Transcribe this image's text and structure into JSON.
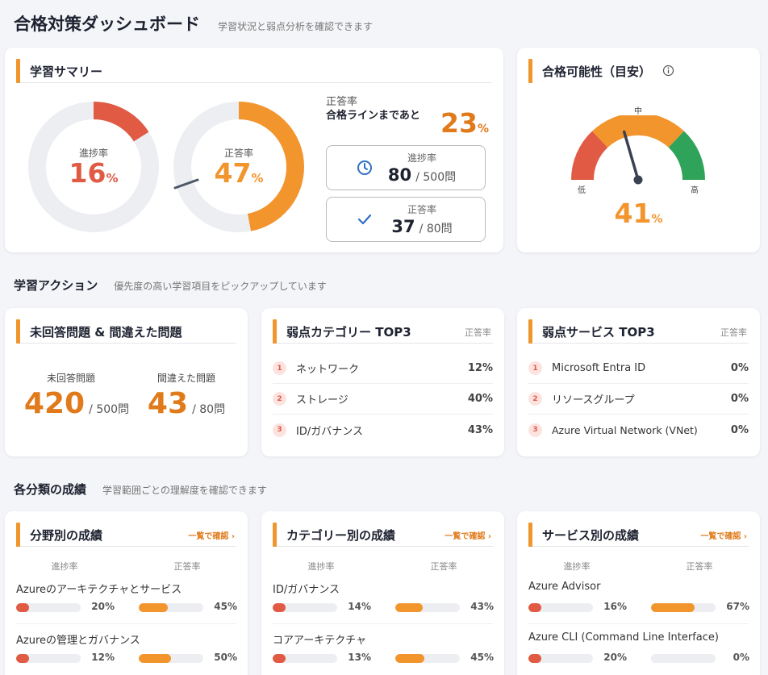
{
  "header": {
    "title": "合格対策ダッシュボード",
    "subtitle": "学習状況と弱点分析を確認できます"
  },
  "summary": {
    "title": "学習サマリー",
    "progress": {
      "label": "進捗率",
      "value": "16",
      "unit": "%",
      "fraction": 0.16
    },
    "accuracy": {
      "label": "正答率",
      "value": "47",
      "unit": "%",
      "fraction": 0.47
    },
    "gap": {
      "label": "正答率",
      "text": "合格ラインまであと",
      "value": "23",
      "unit": "%"
    },
    "progress_box": {
      "label": "進捗率",
      "value": "80",
      "total": "/ 500問"
    },
    "accuracy_box": {
      "label": "正答率",
      "value": "37",
      "total": "/ 80問"
    }
  },
  "pass": {
    "title": "合格可能性（目安）",
    "low": "低",
    "mid": "中",
    "high": "高",
    "value": "41",
    "unit": "%",
    "fraction": 0.41
  },
  "actions": {
    "title": "学習アクション",
    "subtitle": "優先度の高い学習項目をピックアップしています",
    "unanswered": {
      "title": "未回答問題 & 間違えた問題",
      "unanswered_label": "未回答問題",
      "unanswered_value": "420",
      "unanswered_total": "/ 500問",
      "wrong_label": "間違えた問題",
      "wrong_value": "43",
      "wrong_total": "/ 80問"
    },
    "weak_categories": {
      "title": "弱点カテゴリー TOP3",
      "right": "正答率",
      "items": [
        {
          "rank": "1",
          "name": "ネットワーク",
          "value": "12%"
        },
        {
          "rank": "2",
          "name": "ストレージ",
          "value": "40%"
        },
        {
          "rank": "3",
          "name": "ID/ガバナンス",
          "value": "43%"
        }
      ]
    },
    "weak_services": {
      "title": "弱点サービス TOP3",
      "right": "正答率",
      "items": [
        {
          "rank": "1",
          "name": "Microsoft Entra ID",
          "value": "0%"
        },
        {
          "rank": "2",
          "name": "リソースグループ",
          "value": "0%"
        },
        {
          "rank": "3",
          "name": "Azure Virtual Network (VNet)",
          "value": "0%"
        }
      ]
    }
  },
  "scores": {
    "title": "各分類の成績",
    "subtitle": "学習範囲ごとの理解度を確認できます",
    "cards": [
      {
        "title": "分野別の成績",
        "link": "一覧で確認 ›",
        "col1": "進捗率",
        "col2": "正答率",
        "items": [
          {
            "name": "Azureのアーキテクチャとサービス",
            "progress": "20%",
            "pf": 0.2,
            "accuracy": "45%",
            "af": 0.45
          },
          {
            "name": "Azureの管理とガバナンス",
            "progress": "12%",
            "pf": 0.12,
            "accuracy": "50%",
            "af": 0.5
          }
        ]
      },
      {
        "title": "カテゴリー別の成績",
        "link": "一覧で確認 ›",
        "col1": "進捗率",
        "col2": "正答率",
        "items": [
          {
            "name": "ID/ガバナンス",
            "progress": "14%",
            "pf": 0.14,
            "accuracy": "43%",
            "af": 0.43
          },
          {
            "name": "コアアーキテクチャ",
            "progress": "13%",
            "pf": 0.13,
            "accuracy": "45%",
            "af": 0.45
          }
        ]
      },
      {
        "title": "サービス別の成績",
        "link": "一覧で確認 ›",
        "col1": "進捗率",
        "col2": "正答率",
        "items": [
          {
            "name": "Azure Advisor",
            "progress": "16%",
            "pf": 0.16,
            "accuracy": "67%",
            "af": 0.67
          },
          {
            "name": "Azure CLI (Command Line Interface)",
            "progress": "20%",
            "pf": 0.2,
            "accuracy": "0%",
            "af": 0.0
          }
        ]
      }
    ]
  },
  "colors": {
    "accent": "#f0962e",
    "red": "#e05a44",
    "orange": "#f3952d",
    "green": "#2fa35a",
    "track": "#eceef2"
  },
  "icons": {
    "progress_box": "clock-icon",
    "accuracy_box": "check-icon",
    "pass_info": "info-icon"
  }
}
